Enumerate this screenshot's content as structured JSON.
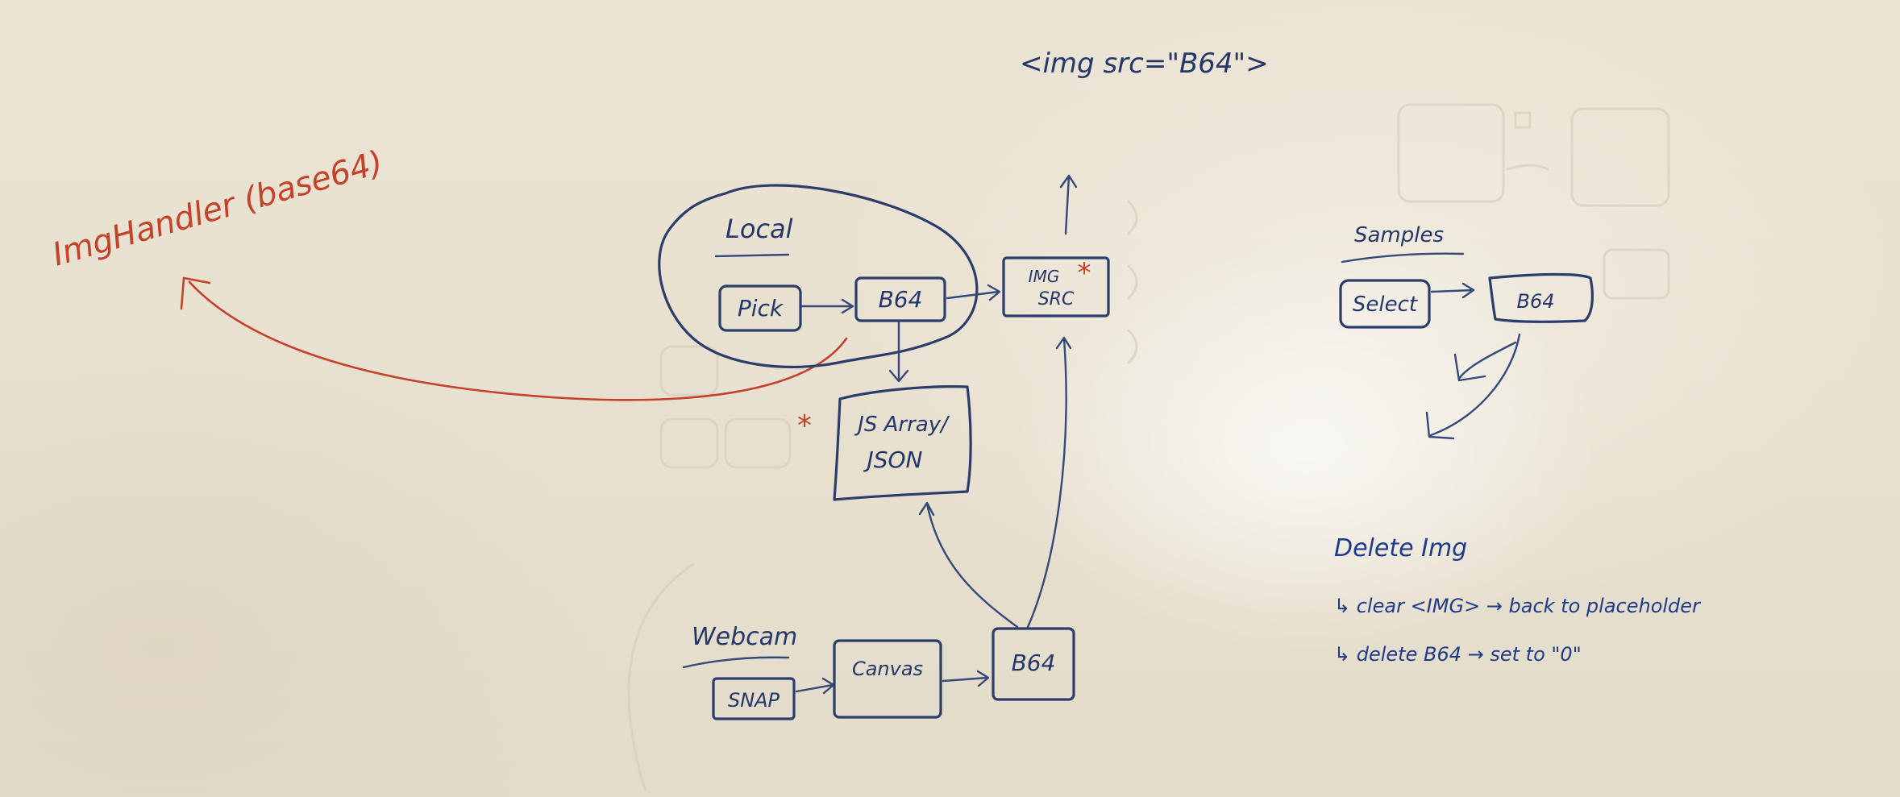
{
  "header_note": "<img src=\"B64\">",
  "handler_note": "ImgHandler (base64)",
  "local": {
    "title": "Local",
    "pick": "Pick",
    "b64": "B64"
  },
  "img_src": {
    "line1": "IMG",
    "line2": "SRC"
  },
  "js_store": {
    "line1": "JS Array/",
    "line2": "JSON"
  },
  "asterisk": "*",
  "webcam": {
    "title": "Webcam",
    "snap": "SNAP",
    "canvas": "Canvas",
    "b64": "B64"
  },
  "samples": {
    "title": "Samples",
    "select": "Select",
    "b64": "B64"
  },
  "delete_notes": {
    "title": "Delete Img",
    "line1": "↳ clear <IMG> → back to placeholder",
    "line2": "↳ delete B64 → set to \"0\""
  },
  "colors": {
    "board": "#e9e1d1",
    "blue_ink": "#2a3d6b",
    "red_ink": "#c4412a"
  }
}
